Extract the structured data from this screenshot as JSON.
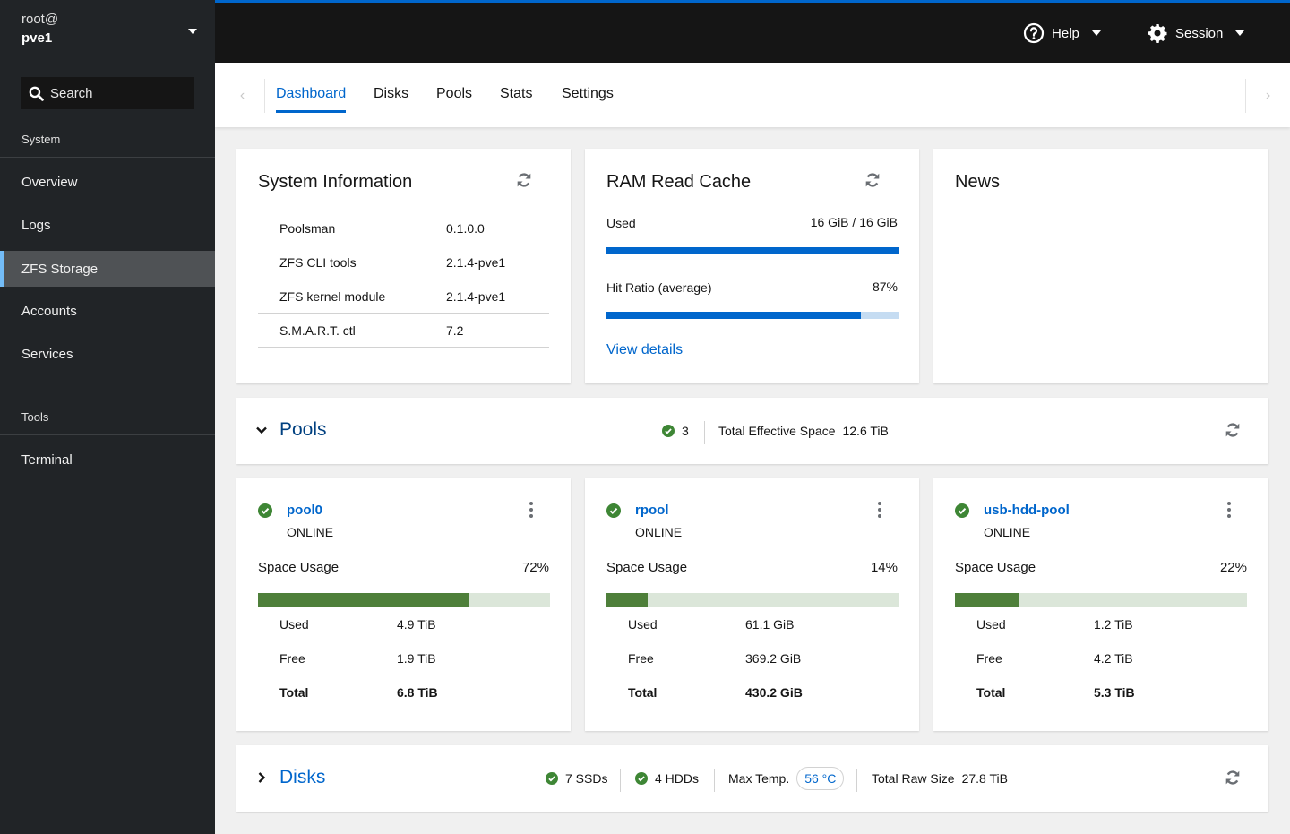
{
  "sidebar": {
    "host_user": "root@",
    "host_name": "pve1",
    "search_label": "Search",
    "sections": [
      {
        "label": "System",
        "items": [
          {
            "label": "Overview",
            "active": false
          },
          {
            "label": "Logs",
            "active": false
          },
          {
            "label": "ZFS Storage",
            "active": true
          },
          {
            "label": "Accounts",
            "active": false
          },
          {
            "label": "Services",
            "active": false
          }
        ]
      },
      {
        "label": "Tools",
        "items": [
          {
            "label": "Terminal",
            "active": false
          }
        ]
      }
    ]
  },
  "topbar": {
    "help_label": "Help",
    "session_label": "Session"
  },
  "tabs": [
    {
      "label": "Dashboard",
      "active": true
    },
    {
      "label": "Disks",
      "active": false
    },
    {
      "label": "Pools",
      "active": false
    },
    {
      "label": "Stats",
      "active": false
    },
    {
      "label": "Settings",
      "active": false
    }
  ],
  "system_info": {
    "title": "System Information",
    "rows": [
      {
        "key": "Poolsman",
        "value": "0.1.0.0"
      },
      {
        "key": "ZFS CLI tools",
        "value": "2.1.4-pve1"
      },
      {
        "key": "ZFS kernel module",
        "value": "2.1.4-pve1"
      },
      {
        "key": "S.M.A.R.T. ctl",
        "value": "7.2"
      }
    ]
  },
  "ram_cache": {
    "title": "RAM Read Cache",
    "used_label": "Used",
    "used_value": "16 GiB / 16 GiB",
    "used_fraction": 1.0,
    "hit_label": "Hit Ratio (average)",
    "hit_value": "87%",
    "hit_fraction": 0.87,
    "link": "View details"
  },
  "news": {
    "title": "News"
  },
  "pools_section": {
    "title": "Pools",
    "online_count": "3",
    "total_label": "Total Effective Space",
    "total_value": "12.6 TiB"
  },
  "pools": [
    {
      "name": "pool0",
      "state": "ONLINE",
      "usage_label": "Space Usage",
      "usage_pct": "72%",
      "usage_fraction": 0.72,
      "rows": [
        {
          "key": "Used",
          "value": "4.9 TiB"
        },
        {
          "key": "Free",
          "value": "1.9 TiB"
        },
        {
          "key": "Total",
          "value": "6.8 TiB"
        }
      ]
    },
    {
      "name": "rpool",
      "state": "ONLINE",
      "usage_label": "Space Usage",
      "usage_pct": "14%",
      "usage_fraction": 0.14,
      "rows": [
        {
          "key": "Used",
          "value": "61.1 GiB"
        },
        {
          "key": "Free",
          "value": "369.2 GiB"
        },
        {
          "key": "Total",
          "value": "430.2 GiB"
        }
      ]
    },
    {
      "name": "usb-hdd-pool",
      "state": "ONLINE",
      "usage_label": "Space Usage",
      "usage_pct": "22%",
      "usage_fraction": 0.22,
      "rows": [
        {
          "key": "Used",
          "value": "1.2 TiB"
        },
        {
          "key": "Free",
          "value": "4.2 TiB"
        },
        {
          "key": "Total",
          "value": "5.3 TiB"
        }
      ]
    }
  ],
  "disks_section": {
    "title": "Disks",
    "ssds": "7 SSDs",
    "hdds": "4 HDDs",
    "max_temp_label": "Max Temp.",
    "max_temp_value": "56 °C",
    "raw_label": "Total Raw Size",
    "raw_value": "27.8 TiB"
  },
  "colors": {
    "accent": "#0066cc",
    "success": "#3e8635",
    "usage_bar": "#4e7f3a",
    "sidebar_bg": "#212427",
    "topbar_bg": "#151515"
  }
}
